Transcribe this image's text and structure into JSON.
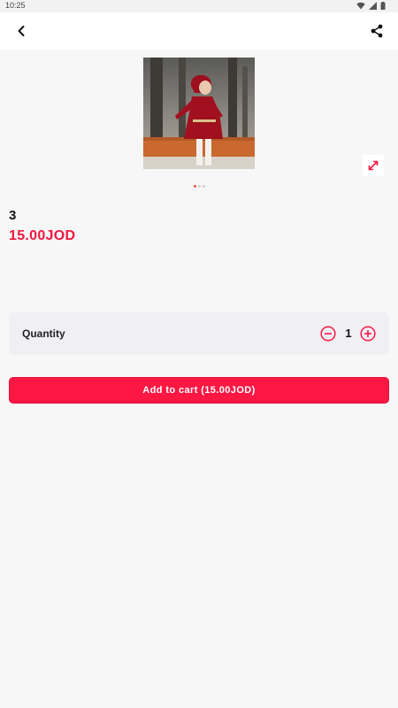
{
  "status_bar": {
    "time": "10:25",
    "icons": [
      "wifi-icon",
      "signal-icon",
      "battery-icon"
    ]
  },
  "app_bar": {
    "back_icon": "chevron-left-icon",
    "share_icon": "share-icon"
  },
  "gallery": {
    "image_count": 3,
    "active_index": 0,
    "expand_icon": "expand-arrows-icon"
  },
  "product": {
    "name": "3",
    "price": "15.00JOD"
  },
  "quantity": {
    "label": "Quantity",
    "value": "1",
    "minus_icon": "minus-circle-icon",
    "plus_icon": "plus-circle-icon"
  },
  "cart_button": {
    "label": "Add to cart (15.00JOD)"
  },
  "colors": {
    "accent": "#ff1744",
    "price": "#f0183f",
    "background": "#f7f7f7"
  }
}
